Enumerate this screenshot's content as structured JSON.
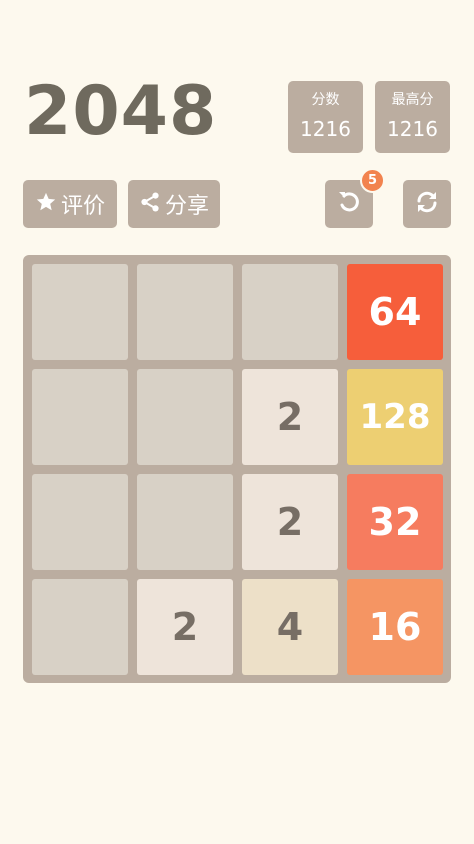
{
  "header": {
    "title": "2048",
    "score_label": "分数",
    "score_value": "1216",
    "best_label": "最高分",
    "best_value": "1216"
  },
  "toolbar": {
    "rate_label": "评价",
    "share_label": "分享",
    "undo_count": "5"
  },
  "board": {
    "grid": [
      [
        "",
        "",
        "",
        "64"
      ],
      [
        "",
        "",
        "2",
        "128"
      ],
      [
        "",
        "",
        "2",
        "32"
      ],
      [
        "",
        "2",
        "4",
        "16"
      ]
    ]
  },
  "colors": {
    "background": "#fdf9ee",
    "board": "#bbada0",
    "empty_cell": "#d8d1c6",
    "tile_2": "#eee4da",
    "tile_4": "#ede0c8",
    "tile_16": "#f59563",
    "tile_32": "#f67c5f",
    "tile_64": "#f65e3b",
    "tile_128": "#edcf72",
    "badge": "#f2834e"
  },
  "icons": {
    "rate": "star-icon",
    "share": "share-icon",
    "undo": "undo-icon",
    "restart": "refresh-icon"
  }
}
